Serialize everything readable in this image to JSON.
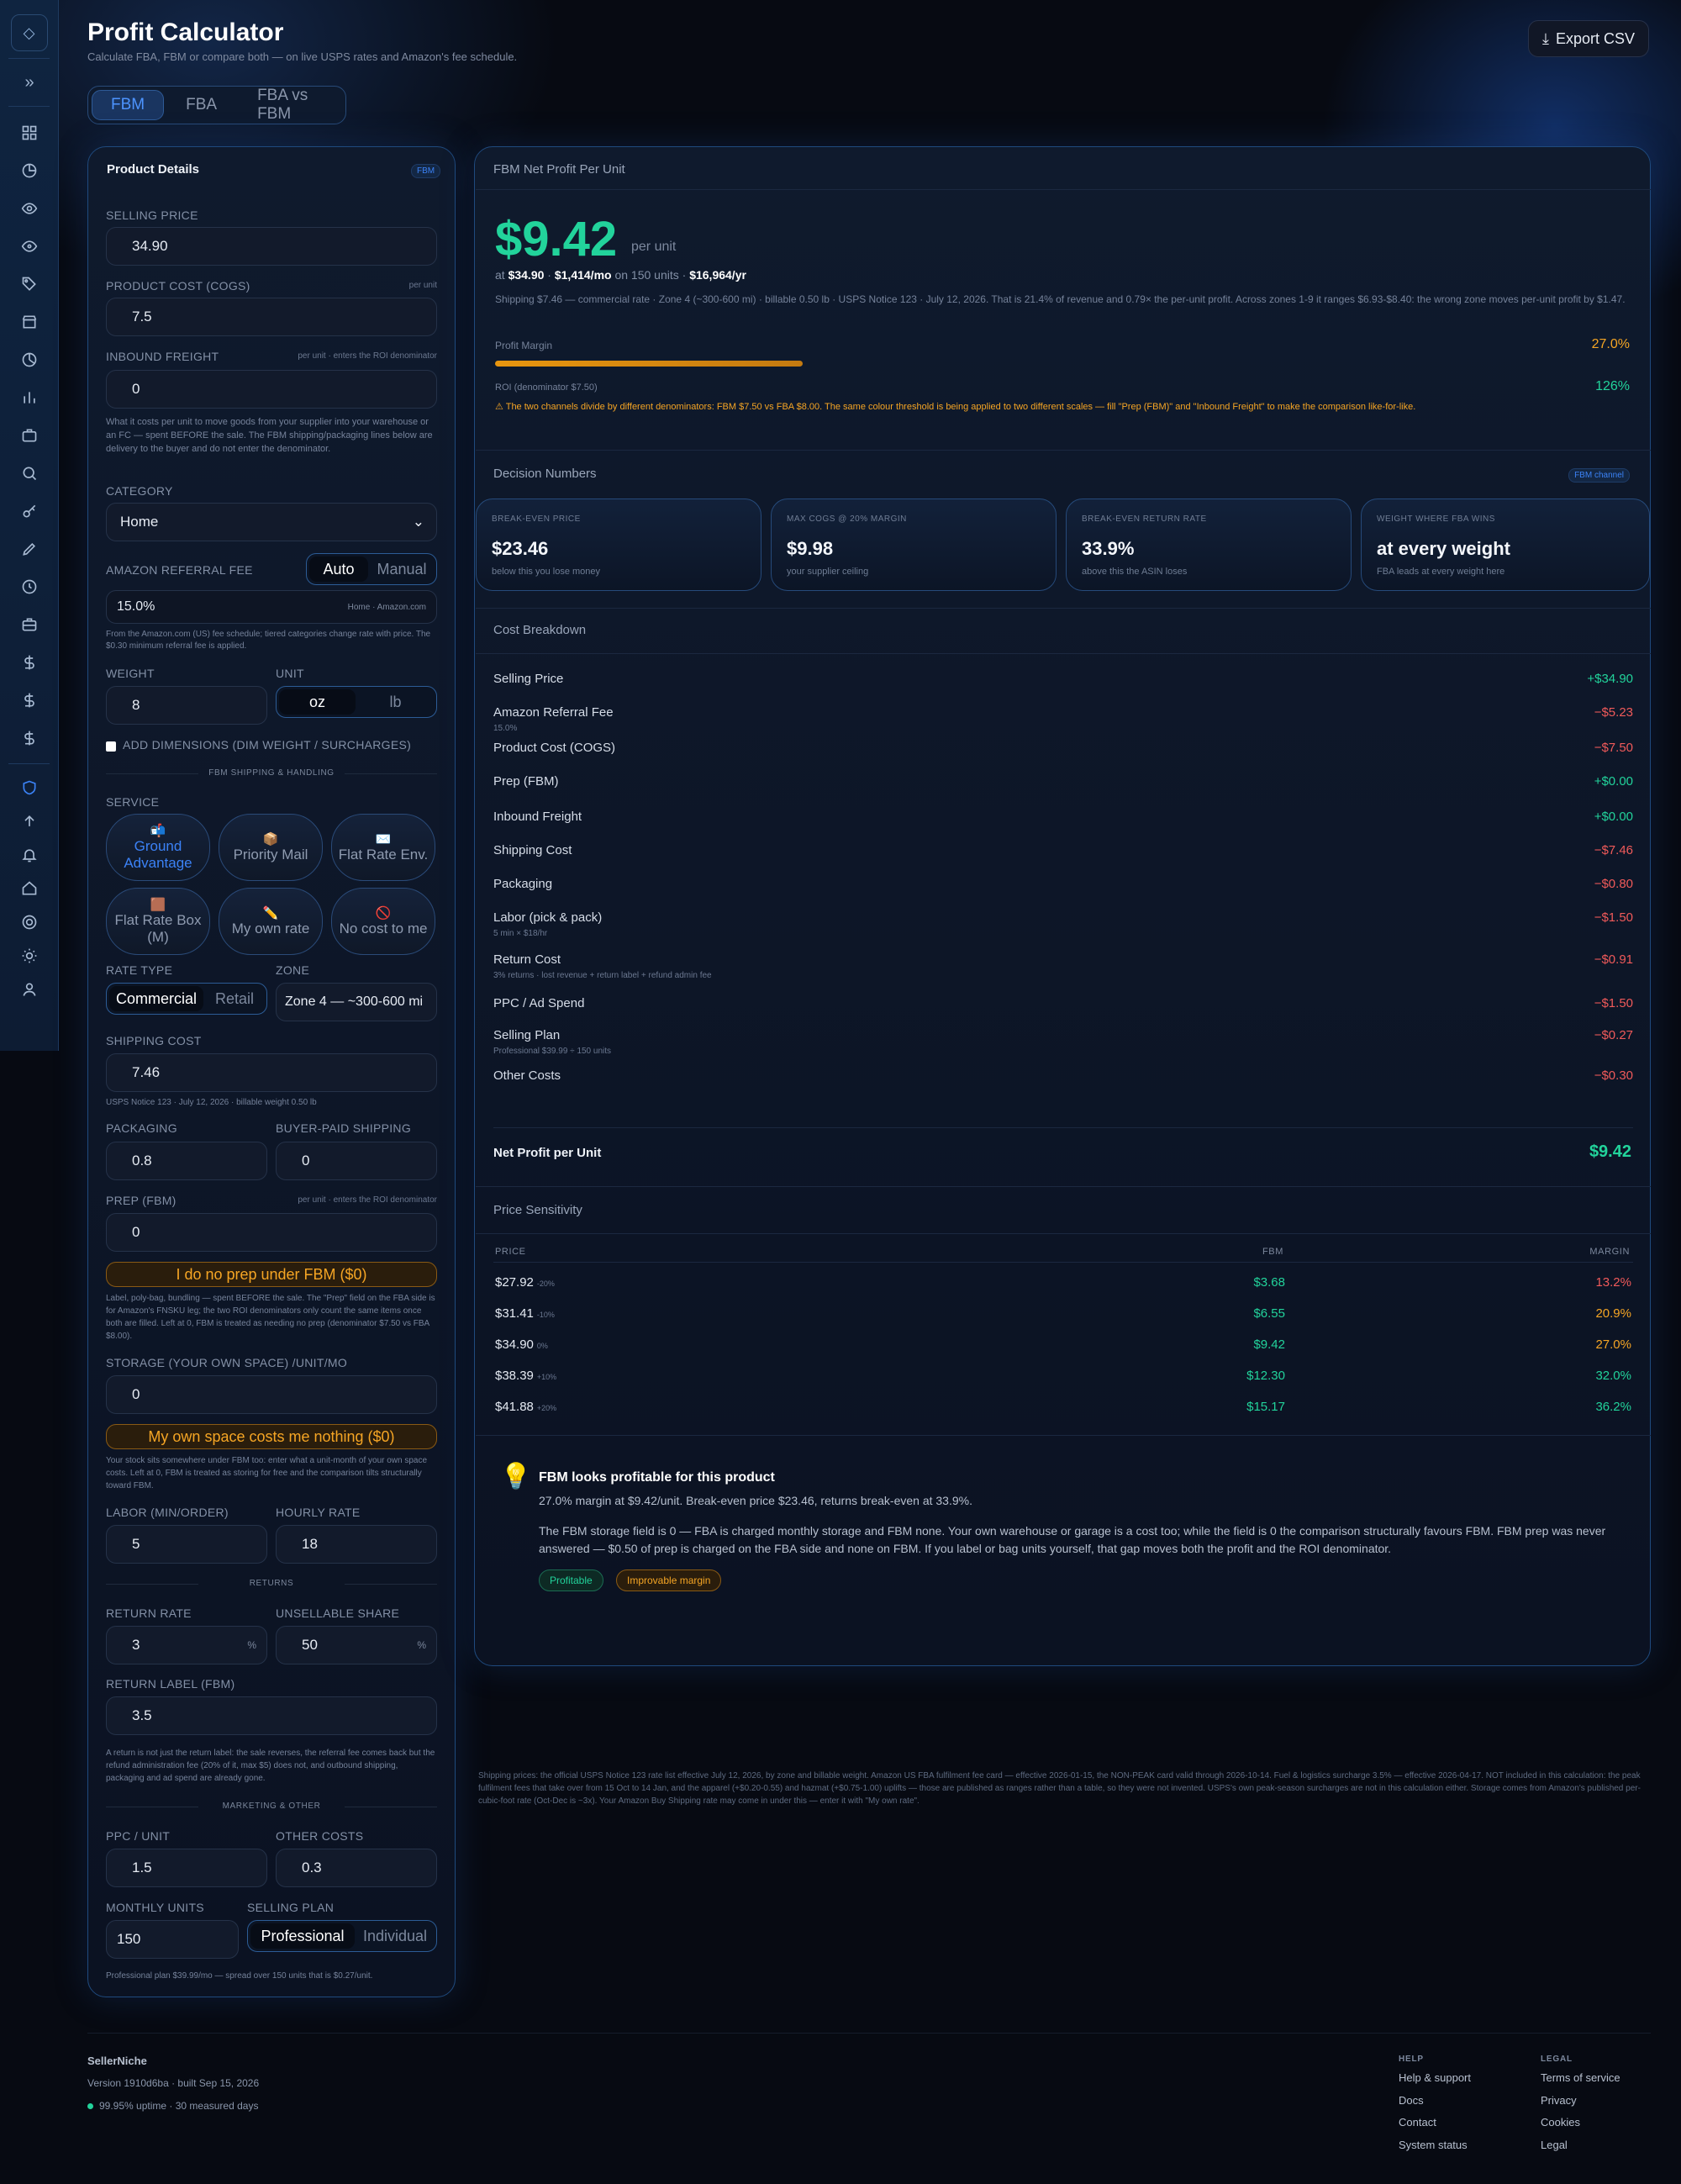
{
  "header": {
    "title": "Profit Calculator",
    "subtitle": "Calculate FBA, FBM or compare both — on live USPS rates and Amazon's fee schedule.",
    "export": "Export CSV"
  },
  "tabs": [
    "FBM",
    "FBA",
    "FBA vs FBM"
  ],
  "left": {
    "title": "Product Details",
    "badge": "FBM",
    "selling_price": {
      "label": "SELLING PRICE",
      "value": "34.90"
    },
    "cogs": {
      "label": "PRODUCT COST (COGS)",
      "hint": "per unit",
      "value": "7.5"
    },
    "inbound": {
      "label": "INBOUND FREIGHT",
      "hint": "per unit · enters the ROI denominator",
      "value": "0",
      "note": "What it costs per unit to move goods from your supplier into your warehouse or an FC — spent BEFORE the sale. The FBM shipping/packaging lines below are delivery to the buyer and do not enter the denominator."
    },
    "category": {
      "label": "CATEGORY",
      "value": "Home"
    },
    "referral": {
      "label": "AMAZON REFERRAL FEE",
      "auto": "Auto",
      "manual": "Manual",
      "value": "15.0%",
      "source": "Home · Amazon.com",
      "note": "From the Amazon.com (US) fee schedule; tiered categories change rate with price. The $0.30 minimum referral fee is applied."
    },
    "weight": {
      "label": "WEIGHT",
      "value": "8"
    },
    "unit": {
      "label": "UNIT",
      "oz": "oz",
      "lb": "lb"
    },
    "dims": "ADD DIMENSIONS (DIM WEIGHT / SURCHARGES)",
    "ship_section": "FBM SHIPPING & HANDLING",
    "service": {
      "label": "SERVICE",
      "options": [
        {
          "icon": "📬",
          "label": "Ground Advantage"
        },
        {
          "icon": "📦",
          "label": "Priority Mail"
        },
        {
          "icon": "✉️",
          "label": "Flat Rate Env."
        },
        {
          "icon": "🟫",
          "label": "Flat Rate Box (M)"
        },
        {
          "icon": "✏️",
          "label": "My own rate"
        },
        {
          "icon": "🚫",
          "label": "No cost to me"
        }
      ]
    },
    "rate_type": {
      "label": "RATE TYPE",
      "a": "Commercial",
      "b": "Retail"
    },
    "zone": {
      "label": "ZONE",
      "value": "Zone 4 — ~300-600 mi"
    },
    "shipping": {
      "label": "SHIPPING COST",
      "value": "7.46",
      "note": "USPS Notice 123 · July 12, 2026 · billable weight 0.50 lb"
    },
    "packaging": {
      "label": "PACKAGING",
      "value": "0.8"
    },
    "buyer_ship": {
      "label": "BUYER-PAID SHIPPING",
      "value": "0"
    },
    "prep": {
      "label": "PREP (FBM)",
      "hint": "per unit · enters the ROI denominator",
      "value": "0",
      "button": "I do no prep under FBM ($0)",
      "note": "Label, poly-bag, bundling — spent BEFORE the sale. The \"Prep\" field on the FBA side is for Amazon's FNSKU leg; the two ROI denominators only count the same items once both are filled. Left at 0, FBM is treated as needing no prep (denominator $7.50 vs FBA $8.00)."
    },
    "storage": {
      "label": "STORAGE (YOUR OWN SPACE) /UNIT/MO",
      "value": "0",
      "button": "My own space costs me nothing ($0)",
      "note": "Your stock sits somewhere under FBM too: enter what a unit-month of your own space costs. Left at 0, FBM is treated as storing for free and the comparison tilts structurally toward FBM."
    },
    "labor": {
      "label": "LABOR (MIN/ORDER)",
      "value": "5"
    },
    "hourly": {
      "label": "HOURLY RATE",
      "value": "18"
    },
    "returns_section": "RETURNS",
    "return_rate": {
      "label": "RETURN RATE",
      "value": "3",
      "unit": "%"
    },
    "unsellable": {
      "label": "UNSELLABLE SHARE",
      "value": "50",
      "unit": "%"
    },
    "return_label": {
      "label": "RETURN LABEL (FBM)",
      "value": "3.5",
      "note": "A return is not just the return label: the sale reverses, the referral fee comes back but the refund administration fee (20% of it, max $5) does not, and outbound shipping, packaging and ad spend are already gone."
    },
    "marketing_section": "MARKETING & OTHER",
    "ppc": {
      "label": "PPC / UNIT",
      "value": "1.5"
    },
    "other": {
      "label": "OTHER COSTS",
      "value": "0.3"
    },
    "monthly": {
      "label": "MONTHLY UNITS",
      "value": "150"
    },
    "plan": {
      "label": "SELLING PLAN",
      "a": "Professional",
      "b": "Individual",
      "note": "Professional plan $39.99/mo — spread over 150 units that is $0.27/unit."
    }
  },
  "profit": {
    "title": "FBM Net Profit Per Unit",
    "value": "$9.42",
    "per": "per unit",
    "at": "at",
    "price": "$34.90",
    "mo": "$1,414/mo",
    "on": "on 150 units ·",
    "yr": "$16,964/yr",
    "detail": "Shipping $7.46 — commercial rate · Zone 4 (~300-600 mi) · billable 0.50 lb · USPS Notice 123 · July 12, 2026. That is 21.4% of revenue and 0.79× the per-unit profit. Across zones 1-9 it ranges $6.93-$8.40: the wrong zone moves per-unit profit by $1.47.",
    "margin_label": "Profit Margin",
    "margin": "27.0%",
    "margin_fraction": 0.27,
    "roi_label": "ROI (denominator $7.50)",
    "roi": "126%",
    "warning": "⚠ The two channels divide by different denominators: FBM $7.50 vs FBA $8.00. The same colour threshold is being applied to two different scales — fill \"Prep (FBM)\" and \"Inbound Freight\" to make the comparison like-for-like."
  },
  "decision": {
    "title": "Decision Numbers",
    "badge": "FBM channel",
    "cards": [
      {
        "t": "BREAK-EVEN PRICE",
        "v": "$23.46",
        "s": "below this you lose money"
      },
      {
        "t": "MAX COGS @ 20% MARGIN",
        "v": "$9.98",
        "s": "your supplier ceiling"
      },
      {
        "t": "BREAK-EVEN RETURN RATE",
        "v": "33.9%",
        "s": "above this the ASIN loses"
      },
      {
        "t": "WEIGHT WHERE FBA WINS",
        "v": "at every weight",
        "s": "FBA leads at every weight here"
      }
    ]
  },
  "breakdown": {
    "title": "Cost Breakdown",
    "rows": [
      {
        "n": "Selling Price",
        "d": "",
        "a": "+$34.90",
        "c": "pos"
      },
      {
        "n": "Amazon Referral Fee",
        "d": "15.0%",
        "a": "−$5.23",
        "c": "neg"
      },
      {
        "n": "Product Cost (COGS)",
        "d": "",
        "a": "−$7.50",
        "c": "neg"
      },
      {
        "n": "Prep (FBM)",
        "d": "",
        "a": "+$0.00",
        "c": "pos"
      },
      {
        "n": "Inbound Freight",
        "d": "",
        "a": "+$0.00",
        "c": "pos"
      },
      {
        "n": "Shipping Cost",
        "d": "",
        "a": "−$7.46",
        "c": "neg"
      },
      {
        "n": "Packaging",
        "d": "",
        "a": "−$0.80",
        "c": "neg"
      },
      {
        "n": "Labor (pick & pack)",
        "d": "5 min × $18/hr",
        "a": "−$1.50",
        "c": "neg"
      },
      {
        "n": "Return Cost",
        "d": "3% returns · lost revenue + return label + refund admin fee",
        "a": "−$0.91",
        "c": "neg"
      },
      {
        "n": "PPC / Ad Spend",
        "d": "",
        "a": "−$1.50",
        "c": "neg"
      },
      {
        "n": "Selling Plan",
        "d": "Professional $39.99 ÷ 150 units",
        "a": "−$0.27",
        "c": "neg"
      },
      {
        "n": "Other Costs",
        "d": "",
        "a": "−$0.30",
        "c": "neg"
      }
    ],
    "net_label": "Net Profit per Unit",
    "net": "$9.42"
  },
  "sensitivity": {
    "title": "Price Sensitivity",
    "h": [
      "PRICE",
      "FBM",
      "MARGIN"
    ],
    "rows": [
      {
        "p": "$27.92",
        "d": "-20%",
        "f": "$3.68",
        "m": "13.2%",
        "mc": "#f05a5a"
      },
      {
        "p": "$31.41",
        "d": "-10%",
        "f": "$6.55",
        "m": "20.9%",
        "mc": "#f5a524"
      },
      {
        "p": "$34.90",
        "d": "0%",
        "f": "$9.42",
        "m": "27.0%",
        "mc": "#f5a524"
      },
      {
        "p": "$38.39",
        "d": "+10%",
        "f": "$12.30",
        "m": "32.0%",
        "mc": "#22d39b"
      },
      {
        "p": "$41.88",
        "d": "+20%",
        "f": "$15.17",
        "m": "36.2%",
        "mc": "#22d39b"
      }
    ]
  },
  "insight": {
    "title": "FBM looks profitable for this product",
    "l1": "27.0% margin at $9.42/unit. Break-even price $23.46, returns break-even at 33.9%.",
    "l2": "The FBM storage field is 0 — FBA is charged monthly storage and FBM none. Your own warehouse or garage is a cost too; while the field is 0 the comparison structurally favours FBM. FBM prep was never answered — $0.50 of prep is charged on the FBA side and none on FBM. If you label or bag units yourself, that gap moves both the profit and the ROI denominator.",
    "tag1": "Profitable",
    "tag2": "Improvable margin"
  },
  "footnote": "Shipping prices: the official USPS Notice 123 rate list effective July 12, 2026, by zone and billable weight. Amazon US FBA fulfilment fee card — effective 2026-01-15, the NON-PEAK card valid through 2026-10-14. Fuel & logistics surcharge 3.5% — effective 2026-04-17. NOT included in this calculation: the peak fulfilment fees that take over from 15 Oct to 14 Jan, and the apparel (+$0.20-0.55) and hazmat (+$0.75-1.00) uplifts — those are published as ranges rather than a table, so they were not invented. USPS's own peak-season surcharges are not in this calculation either. Storage comes from Amazon's published per-cubic-foot rate (Oct-Dec is ~3x). Your Amazon Buy Shipping rate may come in under this — enter it with \"My own rate\".",
  "footer": {
    "brand": "SellerNiche",
    "version": "Version 1910d6ba · built Sep 15, 2026",
    "uptime": "99.95% uptime · 30 measured days",
    "help_h": "HELP",
    "help": [
      "Help & support",
      "Docs",
      "Contact",
      "System status"
    ],
    "legal_h": "LEGAL",
    "legal": [
      "Terms of service",
      "Privacy",
      "Cookies",
      "Legal"
    ]
  }
}
